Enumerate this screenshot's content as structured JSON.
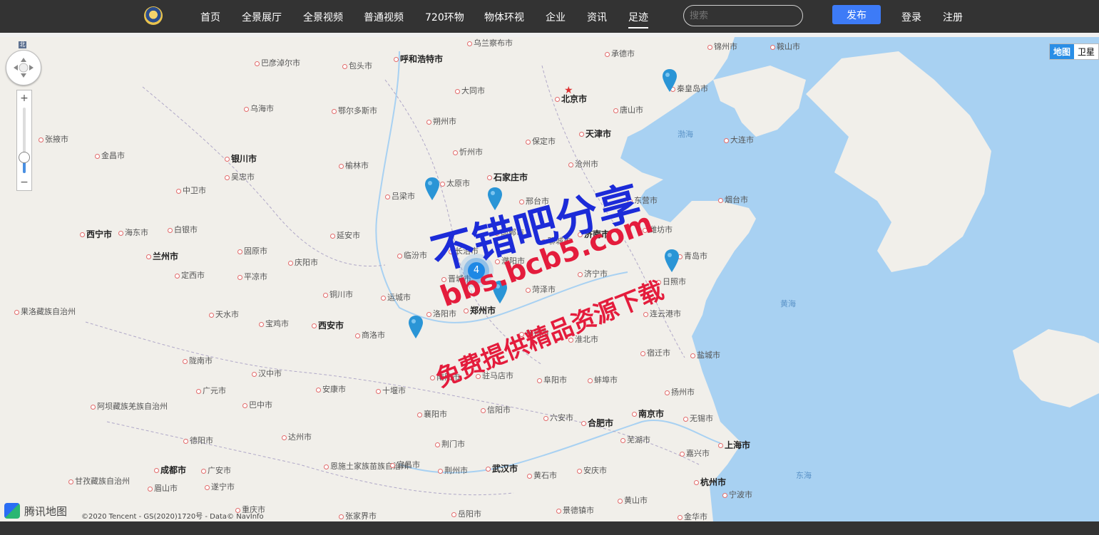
{
  "nav": {
    "items": [
      "首页",
      "全景展厅",
      "全景视频",
      "普通视频",
      "720环物",
      "物体环视",
      "企业",
      "资讯",
      "足迹"
    ],
    "active": "足迹",
    "search_placeholder": "搜索",
    "publish_label": "发布",
    "login_label": "登录",
    "register_label": "注册"
  },
  "map": {
    "type_options": [
      "地图",
      "卫星"
    ],
    "selected_type": "地图",
    "compass_label": "北",
    "zoom_in": "+",
    "zoom_out": "−",
    "zoom_level_fraction": 0.23,
    "brand": "腾讯地图",
    "attribution": "©2020 Tencent - GS(2020)1720号 - Data© NavInfo",
    "cluster_count": "4",
    "cities": [
      "锦州市",
      "鞍山市",
      "乌兰察布市",
      "承德市",
      "巴彦淖尔市",
      "呼和浩特市",
      "包头市",
      "大同市",
      "北京市",
      "秦皇岛市",
      "唐山市",
      "乌海市",
      "鄂尔多斯市",
      "朔州市",
      "渤海",
      "天津市",
      "大连市",
      "张掖市",
      "保定市",
      "金昌市",
      "忻州市",
      "沧州市",
      "银川市",
      "榆林市",
      "石家庄市",
      "吴忠市",
      "太原市",
      "吕梁市",
      "东营市",
      "烟台市",
      "中卫市",
      "邢台市",
      "潍坊市",
      "白银市",
      "西宁市",
      "海东市",
      "延安市",
      "邯郸市",
      "济南市",
      "兰州市",
      "固原市",
      "临汾市",
      "长治市",
      "聊城市",
      "濮阳市",
      "青岛市",
      "庆阳市",
      "晋城市",
      "济宁市",
      "定西市",
      "平凉市",
      "日照市",
      "铜川市",
      "运城市",
      "菏泽市",
      "郑州市",
      "连云港市",
      "果洛藏族自治州",
      "天水市",
      "洛阳市",
      "宝鸡市",
      "西安市",
      "商洛市",
      "淮北市",
      "徐州市",
      "黄海",
      "盐城市",
      "宿迁市",
      "陇南市",
      "南阳市",
      "驻马店市",
      "阜阳市",
      "蚌埠市",
      "汉中市",
      "十堰市",
      "安康市",
      "信阳市",
      "扬州市",
      "广元市",
      "阿坝藏族羌族自治州",
      "巴中市",
      "襄阳市",
      "六安市",
      "合肥市",
      "南京市",
      "无锡市",
      "德阳市",
      "达州市",
      "荆门市",
      "芜湖市",
      "上海市",
      "嘉兴市",
      "成都市",
      "广安市",
      "恩施土家族苗族自治州",
      "宜昌市",
      "荆州市",
      "武汉市",
      "黄石市",
      "安庆市",
      "东海",
      "杭州市",
      "甘孜藏族自治州",
      "遂宁市",
      "眉山市",
      "宁波市",
      "重庆市",
      "张家界市",
      "岳阳市",
      "景德镇市",
      "黄山市",
      "金华市"
    ]
  },
  "watermark": {
    "line1": "不错吧分享",
    "line2": "bbs.bcb5.com",
    "line3": "免费提供精品资源下载"
  },
  "colors": {
    "topbar": "#333333",
    "publish": "#3d7bf7",
    "sea": "#a8d1f2",
    "land": "#f1efea",
    "pin": "#2a95d6",
    "map_type_active": "#2a8ee6"
  }
}
